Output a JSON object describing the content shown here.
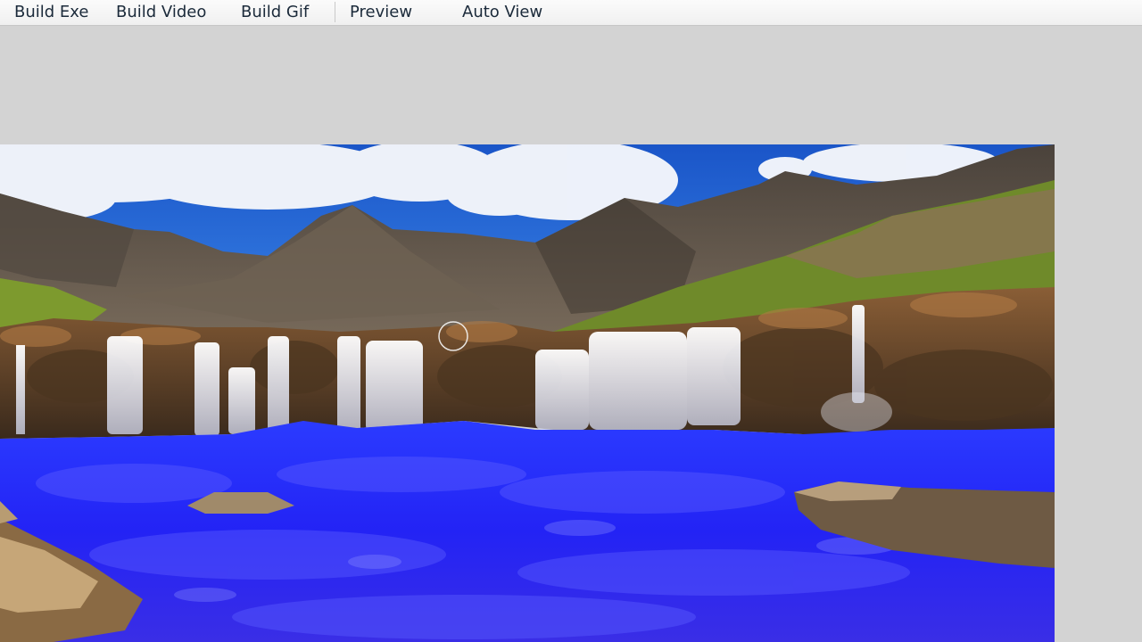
{
  "toolbar": {
    "build_exe": "Build Exe",
    "build_video": "Build Video",
    "build_gif": "Build Gif",
    "preview": "Preview",
    "auto_view": "Auto View"
  },
  "canvas": {
    "image_subject": "waterfall-landscape-with-blue-water",
    "colors": {
      "sky": "#1f63d6",
      "water": "#2323ff",
      "rock": "#6b4a2f",
      "mountain": "#5b524a",
      "grass": "#7d9a2e",
      "background": "#d3d3d3"
    }
  }
}
